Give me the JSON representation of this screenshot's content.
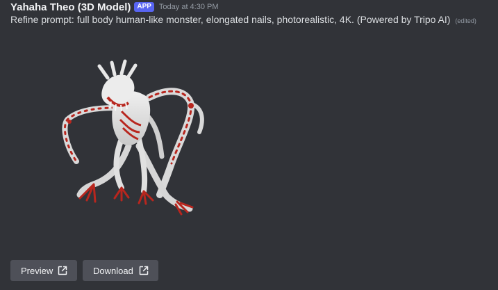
{
  "message": {
    "author": "Yahaha Theo (3D Model)",
    "badge": "APP",
    "timestamp": "Today at 4:30 PM",
    "text": "Refine prompt: full body human-like monster, elongated nails, photorealistic, 4K. (Powered by Tripo AI)",
    "edited_label": "(edited)"
  },
  "attachment": {
    "icon": "monster-model-render"
  },
  "buttons": {
    "preview_label": "Preview",
    "download_label": "Download",
    "icon": "external-link-icon"
  },
  "colors": {
    "background": "#313338",
    "badge": "#5865f2",
    "button": "#4e5058",
    "model_skin": "#dcdcdc",
    "model_accent": "#b8261e"
  }
}
